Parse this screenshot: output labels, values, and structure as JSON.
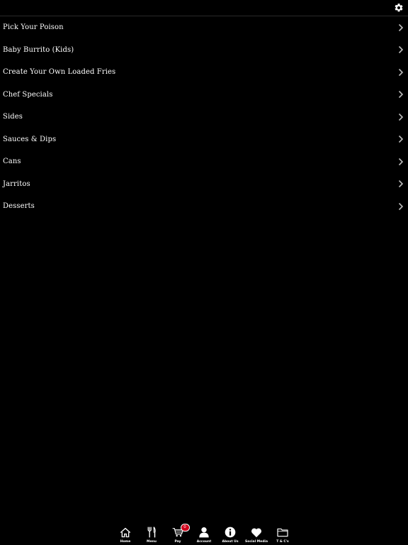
{
  "colors": {
    "background": "#000000",
    "text": "#ffffff",
    "badge": "#d0021b"
  },
  "header": {
    "settings_icon": "gear-icon"
  },
  "menu": {
    "items": [
      {
        "label": "Pick Your Poison"
      },
      {
        "label": "Baby Burrito (Kids)"
      },
      {
        "label": "Create Your Own Loaded Fries"
      },
      {
        "label": "Chef Specials"
      },
      {
        "label": "Sides"
      },
      {
        "label": "Sauces & Dips"
      },
      {
        "label": "Cans"
      },
      {
        "label": "Jarritos"
      },
      {
        "label": "Desserts"
      }
    ]
  },
  "tabbar": {
    "tabs": [
      {
        "label": "Home",
        "icon": "home-icon"
      },
      {
        "label": "Menu",
        "icon": "cutlery-icon"
      },
      {
        "label": "Pay",
        "icon": "cart-icon",
        "badge": "0"
      },
      {
        "label": "Account",
        "icon": "user-icon"
      },
      {
        "label": "About Us",
        "icon": "info-icon"
      },
      {
        "label": "Social Media",
        "icon": "heart-icon"
      },
      {
        "label": "T & C's",
        "icon": "folder-icon"
      }
    ]
  }
}
